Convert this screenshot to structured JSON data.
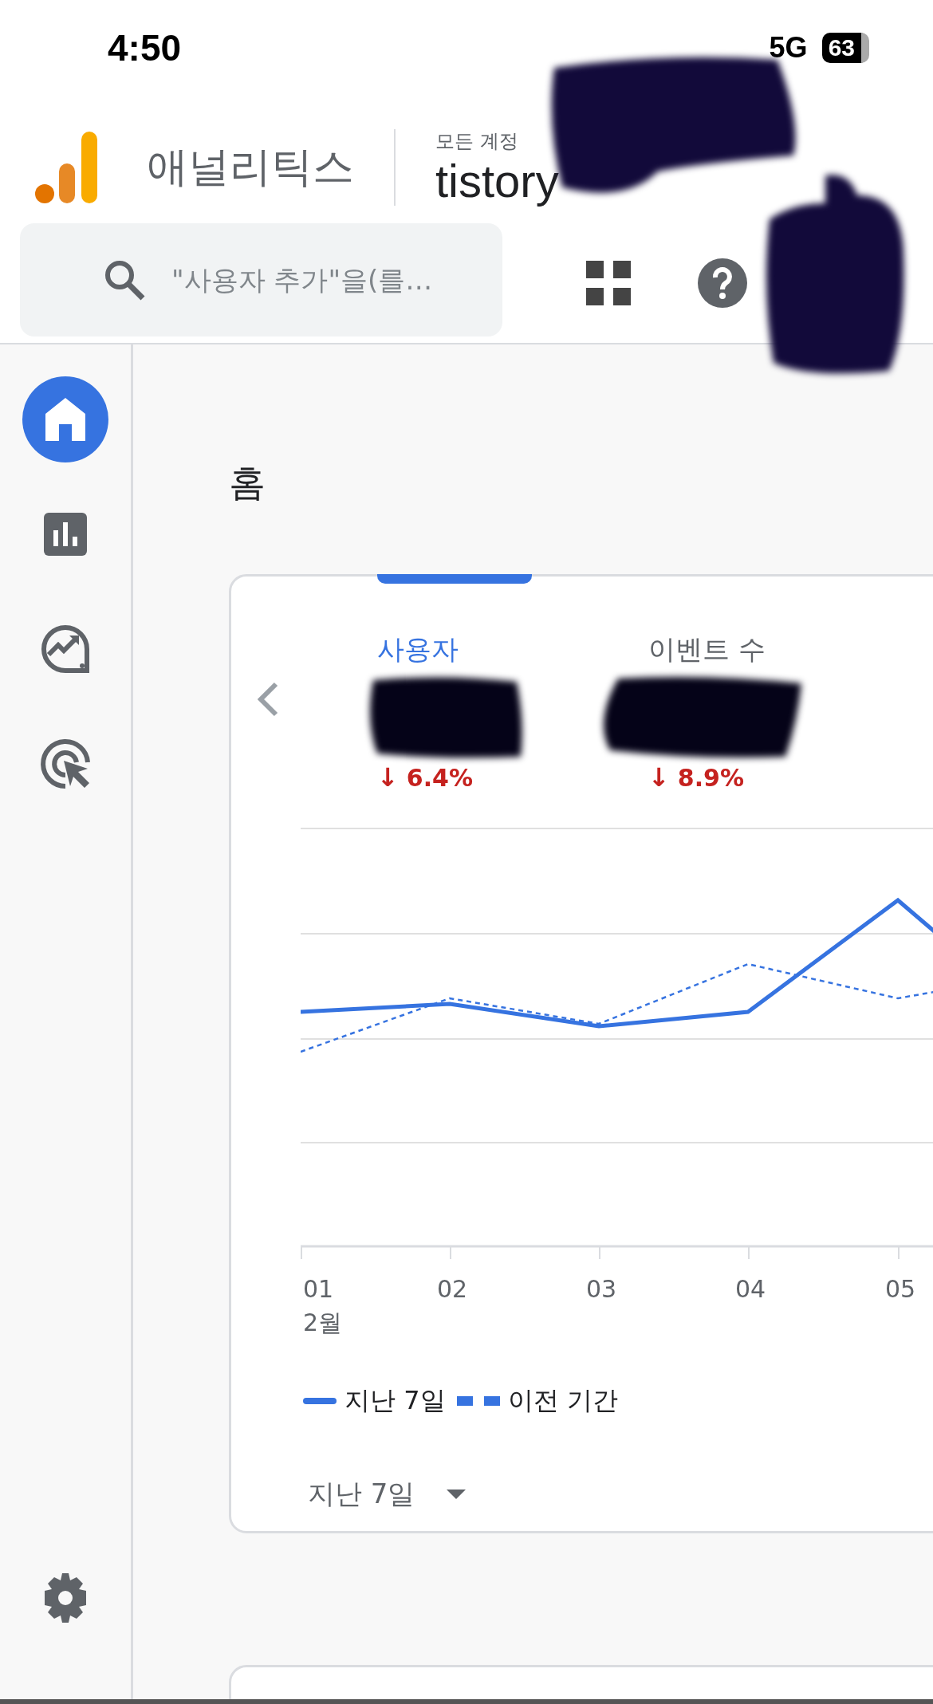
{
  "status_bar": {
    "time": "4:50",
    "network": "5G",
    "battery": "63"
  },
  "header": {
    "app_name": "애널리틱스",
    "account_label": "모든 계정",
    "property": "tistory"
  },
  "search": {
    "placeholder": "\"사용자 추가\"을(를…"
  },
  "sidebar": {
    "items": [
      {
        "kind": "home",
        "selected": true
      },
      {
        "kind": "reports",
        "selected": false
      },
      {
        "kind": "explore",
        "selected": false
      },
      {
        "kind": "advertising",
        "selected": false
      }
    ]
  },
  "page_title": "홈",
  "card": {
    "metrics": [
      {
        "label": "사용자",
        "change": "6.4%",
        "arrow": "↓",
        "selected": true
      },
      {
        "label": "이벤트 수",
        "change": "8.9%",
        "arrow": "↓",
        "selected": false
      }
    ],
    "x_labels": [
      "01",
      "02",
      "03",
      "04",
      "05"
    ],
    "month_label": "2월",
    "legend": [
      {
        "label": "지난 7일",
        "kind": "solid"
      },
      {
        "label": "이전 기간",
        "kind": "dashed"
      }
    ],
    "period": "지난 7일"
  }
}
